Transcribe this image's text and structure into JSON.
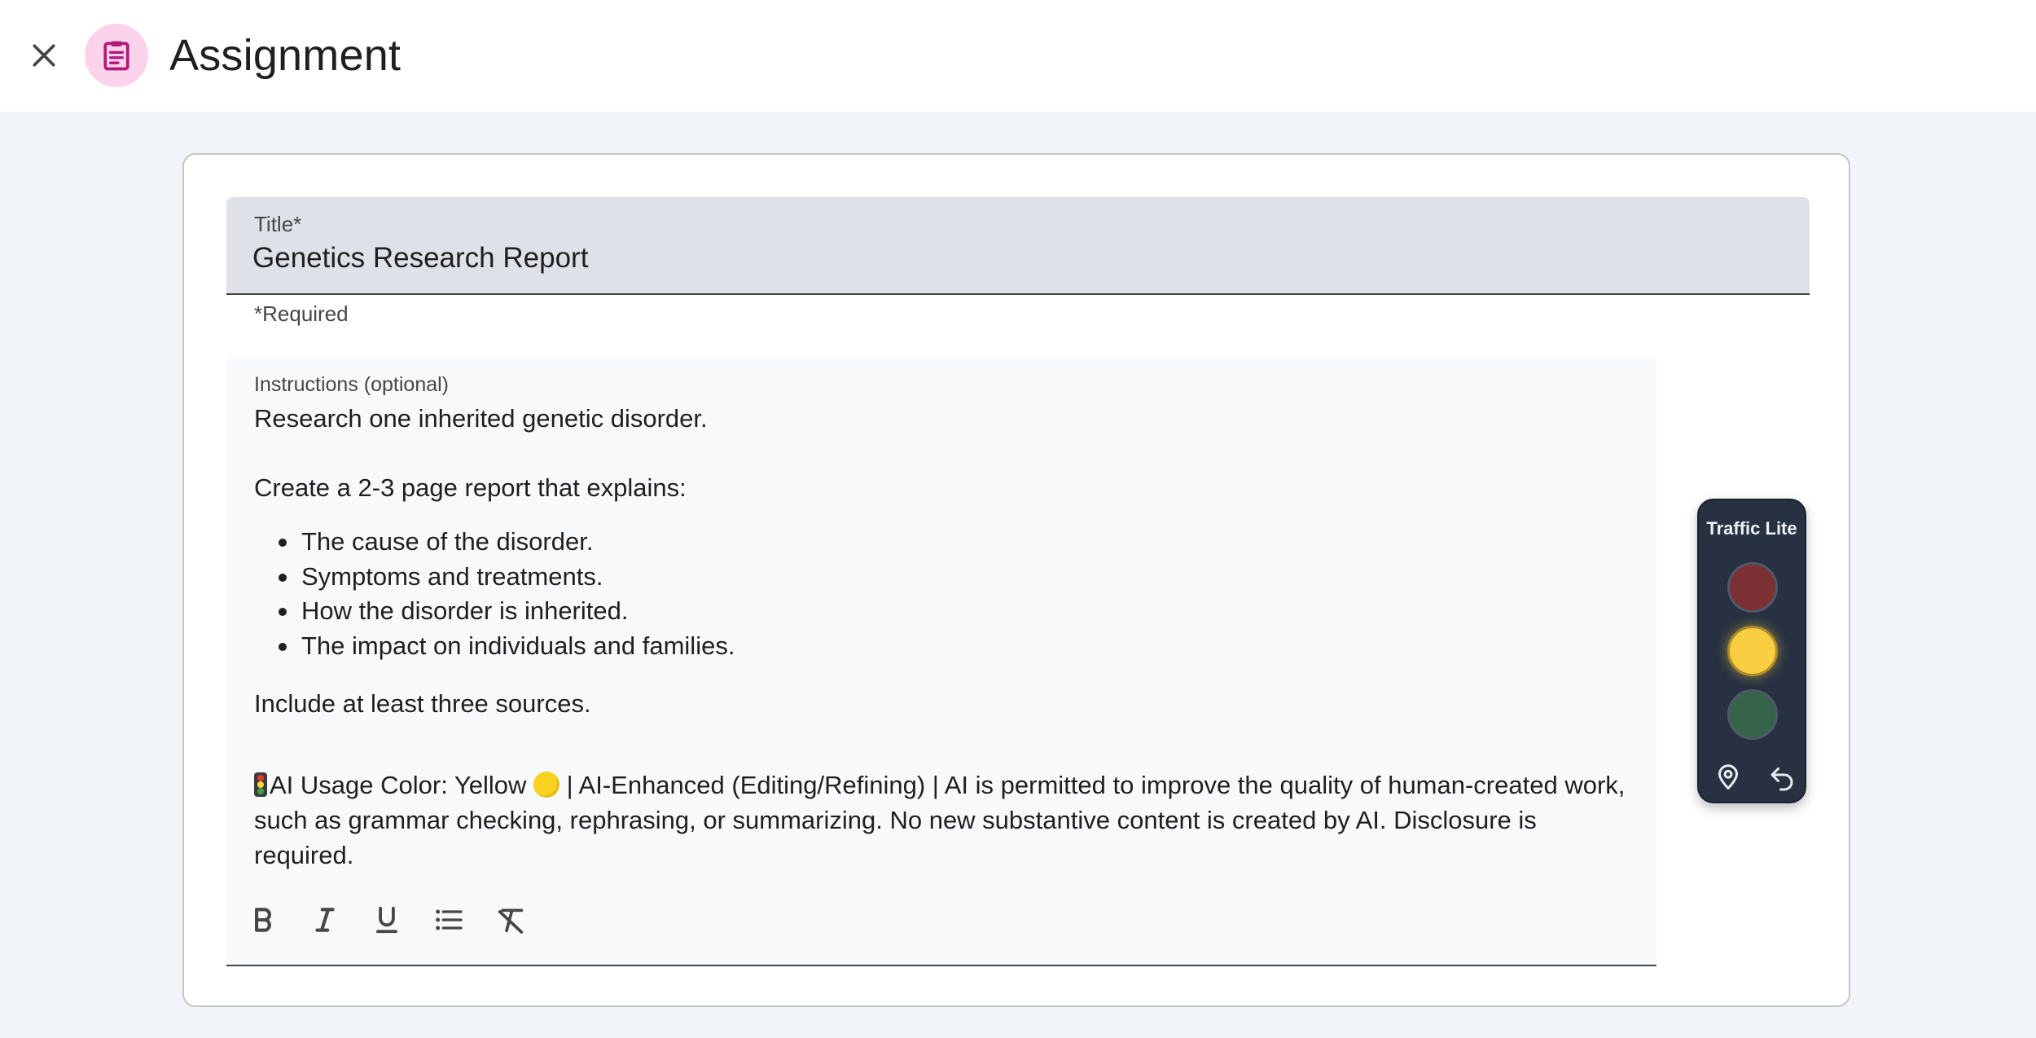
{
  "header": {
    "title": "Assignment",
    "close_icon": "close-icon",
    "app_icon": "assignment-icon",
    "app_icon_bg": "#fbd3eb",
    "app_icon_color": "#b5177a"
  },
  "title_field": {
    "label": "Title*",
    "value": "Genetics Research Report",
    "hint": "*Required"
  },
  "instructions": {
    "label": "Instructions (optional)",
    "line1": "Research one inherited genetic disorder.",
    "line2": "Create a 2-3 page report that explains:",
    "bullets": [
      "The cause of the disorder.",
      "Symptoms and treatments.",
      "How the disorder is inherited.",
      "The impact on individuals and families."
    ],
    "line3": "Include at least three sources.",
    "ai_usage_prefix": "AI Usage Color: Yellow ",
    "ai_usage_rest": " | AI-Enhanced (Editing/Refining) | AI is permitted to improve the quality of human-created work, such as grammar checking, rephrasing, or summarizing. No new substantive content is created by AI. Disclosure is required."
  },
  "toolbar": {
    "buttons": [
      "bold-icon",
      "italic-icon",
      "underline-icon",
      "bulleted-list-icon",
      "clear-formatting-icon"
    ]
  },
  "traffic_widget": {
    "title": "Traffic Lite",
    "active_light": "yellow",
    "colors": {
      "red": "#7b3134",
      "yellow": "#f8cd3f",
      "green": "#35644a",
      "bg": "#273142"
    },
    "buttons": [
      "location-pin-icon",
      "undo-icon"
    ]
  }
}
